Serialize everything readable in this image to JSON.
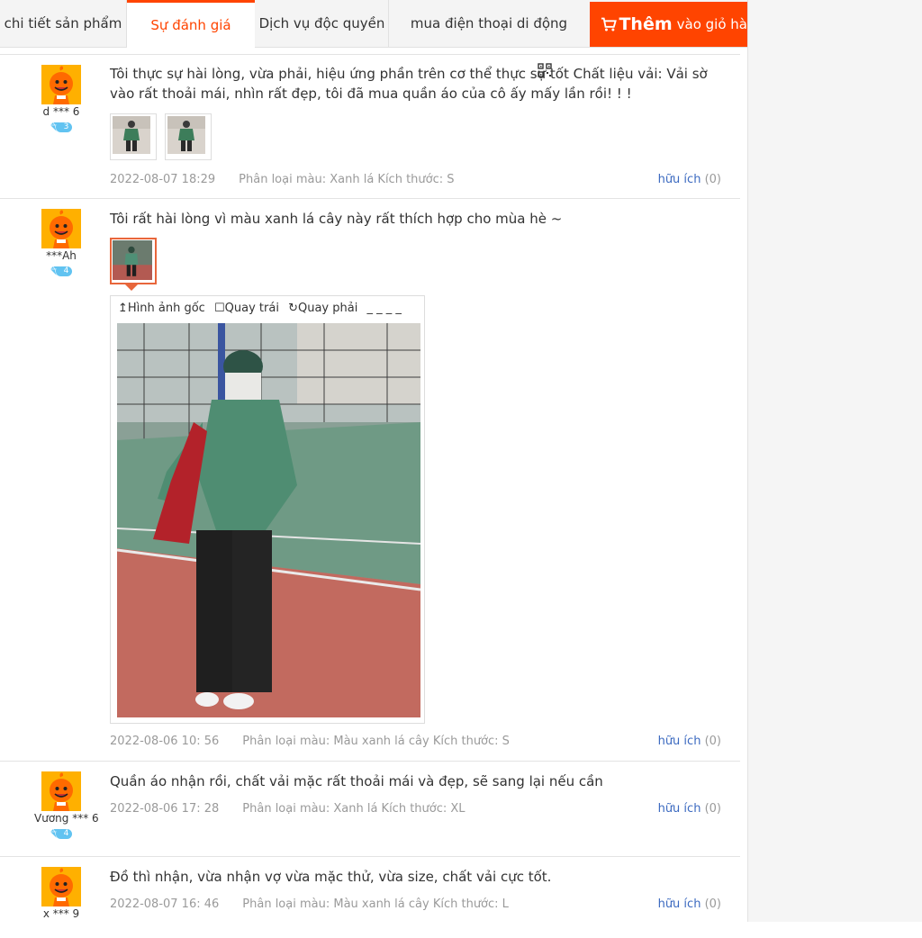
{
  "tabs": [
    {
      "label": "chi tiết sản phẩm"
    },
    {
      "label": "Sự đánh giá"
    },
    {
      "label": "Dịch vụ độc quyền"
    },
    {
      "label": "mua điện thoại di động"
    }
  ],
  "cart_button": {
    "bold": "Thêm",
    "rest": "vào giỏ hà"
  },
  "colors": {
    "accent": "#ff4400",
    "link": "#3c6ac0",
    "meta": "#9a9a9a",
    "vip": "#61c3f1"
  },
  "icons": [
    "cart-icon",
    "qr-code-icon",
    "avatar-mascot-icon",
    "diamond-icon",
    "rotate-left-icon",
    "rotate-right-icon",
    "original-image-icon"
  ],
  "reviews": [
    {
      "user": "d *** 6",
      "level": "3",
      "text": "Tôi thực sự hài lòng, vừa phải, hiệu ứng phần trên cơ thể thực sự tốt Chất liệu vải: Vải sờ vào rất thoải mái, nhìn rất đẹp, tôi đã mua quần áo của cô ấy mấy lần rồi! ! !",
      "date": "2022-08-07 18:29",
      "classification": "Phân loại màu: Xanh lá Kích thước: S",
      "helpful_label": "hữu ích",
      "helpful_count": "(0)"
    },
    {
      "user": "***Ah",
      "level": "4",
      "text": "Tôi rất hài lòng vì màu xanh lá cây này rất thích hợp cho mùa hè ~",
      "date": "2022-08-06 10: 56",
      "classification": "Phân loại màu: Màu xanh lá cây Kích thước: S",
      "helpful_label": "hữu ích",
      "helpful_count": "(0)"
    },
    {
      "user": "Vương *** 6",
      "level": "4",
      "text": "Quần áo nhận rồi, chất vải mặc rất thoải mái và đẹp, sẽ sang lại nếu cần",
      "date": "2022-08-06 17: 28",
      "classification": "Phân loại màu: Xanh lá Kích thước: XL",
      "helpful_label": "hữu ích",
      "helpful_count": "(0)"
    },
    {
      "user": "x *** 9",
      "level": "",
      "text": "Đồ thì nhận, vừa nhận vợ vừa mặc thử, vừa size, chất vải cực tốt.",
      "date": "2022-08-07 16: 46",
      "classification": "Phân loại màu: Màu xanh lá cây Kích thước: L",
      "helpful_label": "hữu ích",
      "helpful_count": "(0)"
    }
  ],
  "viewer": {
    "original": "Hình ảnh gốc",
    "rotate_left": "Quay trái",
    "rotate_right": "Quay phải",
    "trailing": "_ _ _ _"
  }
}
